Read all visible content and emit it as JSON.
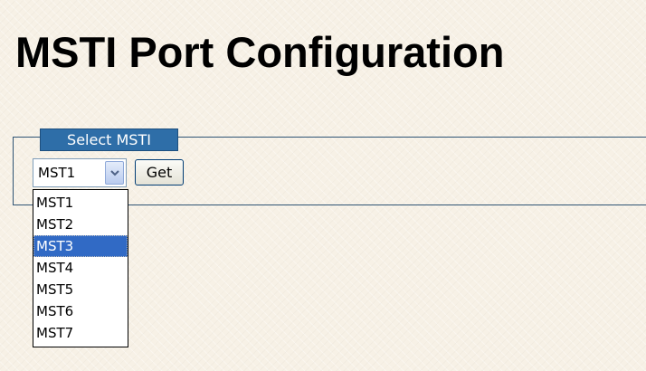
{
  "page": {
    "title": "MSTI Port Configuration"
  },
  "select_msti": {
    "legend": "Select MSTI",
    "selected_value": "MST1",
    "get_button_label": "Get",
    "options": [
      "MST1",
      "MST2",
      "MST3",
      "MST4",
      "MST5",
      "MST6",
      "MST7"
    ],
    "highlighted_option": "MST3"
  },
  "icons": {
    "dropdown_arrow": "chevron-down-icon"
  },
  "colors": {
    "legend_background": "#2e6ea8",
    "highlight": "#316ac5",
    "fieldset_border": "#2f5474",
    "page_background": "#f7f1e6"
  }
}
